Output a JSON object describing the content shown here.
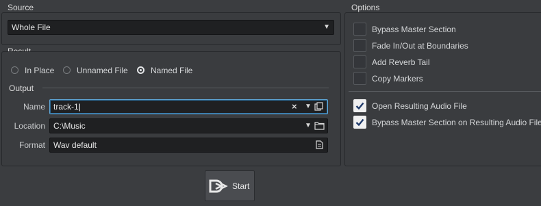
{
  "source": {
    "title": "Source",
    "selected": "Whole File"
  },
  "result": {
    "title": "Result",
    "radios": [
      {
        "label": "In Place",
        "checked": false
      },
      {
        "label": "Unnamed File",
        "checked": false
      },
      {
        "label": "Named File",
        "checked": true
      }
    ]
  },
  "output": {
    "title": "Output",
    "name_label": "Name",
    "name_value": "track-1",
    "location_label": "Location",
    "location_value": "C:\\Music",
    "format_label": "Format",
    "format_value": "Wav default"
  },
  "options": {
    "title": "Options",
    "items": [
      {
        "label": "Bypass Master Section",
        "checked": false
      },
      {
        "label": "Fade In/Out at Boundaries",
        "checked": false
      },
      {
        "label": "Add Reverb Tail",
        "checked": false
      },
      {
        "label": "Copy Markers",
        "checked": false
      },
      {
        "label": "Open Resulting Audio File",
        "checked": true
      },
      {
        "label": "Bypass Master Section on Resulting Audio File",
        "checked": true
      }
    ]
  },
  "start": {
    "label": "Start"
  }
}
